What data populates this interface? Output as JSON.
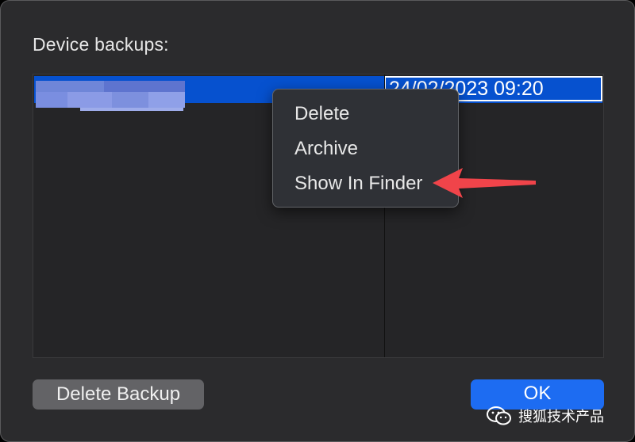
{
  "dialog": {
    "title": "Device backups:"
  },
  "table": {
    "selected_row": {
      "date": "24/02/2023 09:20"
    }
  },
  "context_menu": {
    "items": [
      {
        "label": "Delete"
      },
      {
        "label": "Archive"
      },
      {
        "label": "Show In Finder"
      }
    ]
  },
  "buttons": {
    "delete_backup": "Delete Backup",
    "ok": "OK"
  },
  "watermark": {
    "text": "搜狐技术产品",
    "icon": "wechat-icon"
  },
  "colors": {
    "selection": "#0651cf",
    "ok_button": "#1d6cf2",
    "annotation_arrow": "#f0444a"
  }
}
